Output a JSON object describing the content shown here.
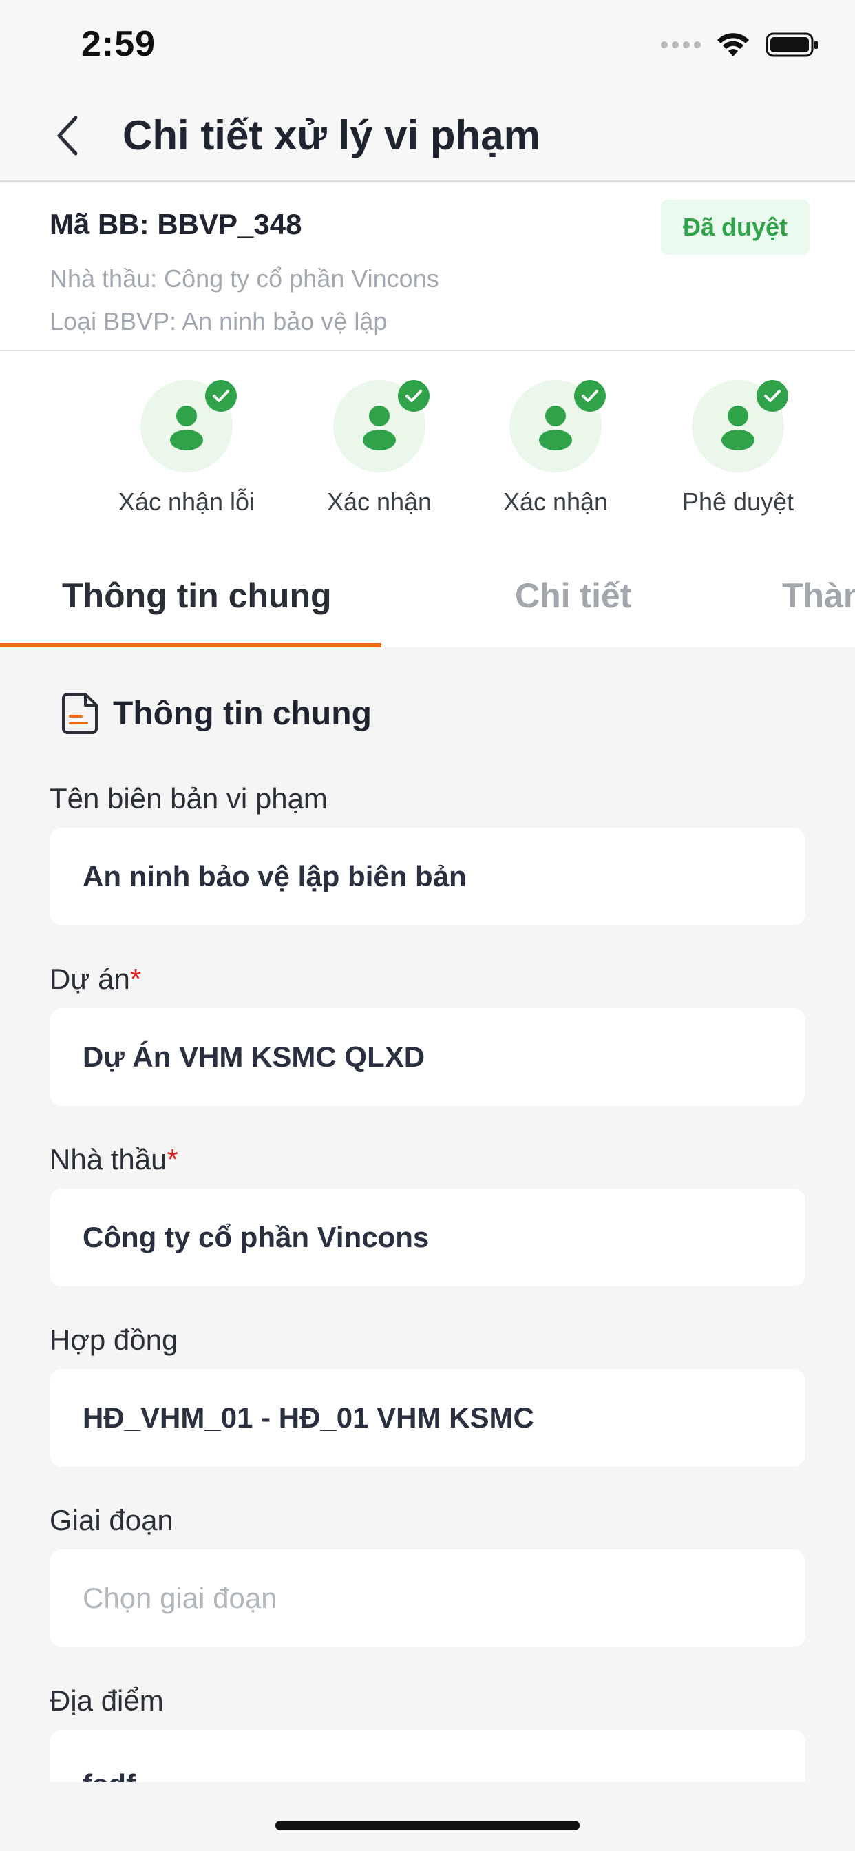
{
  "status_bar": {
    "time": "2:59",
    "icons": [
      "signal-icon",
      "wifi-icon",
      "battery-icon"
    ]
  },
  "header": {
    "title": "Chi tiết xử lý vi phạm",
    "back_icon": "chevron-left-icon"
  },
  "summary": {
    "code": "Mã BB: BBVP_348",
    "status": "Đã duyệt",
    "contractor": "Nhà thầu: Công ty cổ phần Vincons",
    "type": "Loại BBVP: An ninh bảo vệ lập"
  },
  "steps": [
    {
      "label": "Xác nhận lỗi",
      "icon": "user-icon",
      "done": true
    },
    {
      "label": "Xác nhận",
      "icon": "user-icon",
      "done": true
    },
    {
      "label": "Xác nhận",
      "icon": "user-icon",
      "done": true
    },
    {
      "label": "Phê duyệt",
      "icon": "user-icon",
      "done": true
    }
  ],
  "tabs": [
    {
      "label": "Thông tin chung",
      "active": true
    },
    {
      "label": "Chi tiết",
      "active": false
    },
    {
      "label": "Thàn",
      "active": false
    }
  ],
  "section": {
    "title": "Thông tin chung",
    "icon": "document-icon"
  },
  "fields": [
    {
      "label": "Tên biên bản vi phạm",
      "required": false,
      "value": "An ninh bảo vệ lập biên bản"
    },
    {
      "label": "Dự án",
      "required": true,
      "value": "Dự Án VHM KSMC QLXD"
    },
    {
      "label": "Nhà thầu",
      "required": true,
      "value": "Công ty cổ phần Vincons"
    },
    {
      "label": "Hợp đồng",
      "required": false,
      "value": "HĐ_VHM_01 - HĐ_01 VHM KSMC"
    },
    {
      "label": "Giai đoạn",
      "required": false,
      "value": "",
      "placeholder": "Chọn giai đoạn"
    },
    {
      "label": "Địa điểm",
      "required": false,
      "value": "fsdf"
    }
  ],
  "required_mark": "*",
  "colors": {
    "accent": "#ef6c1a",
    "success": "#2fa24a",
    "success_bg": "#eafaef",
    "required": "#e02020"
  }
}
